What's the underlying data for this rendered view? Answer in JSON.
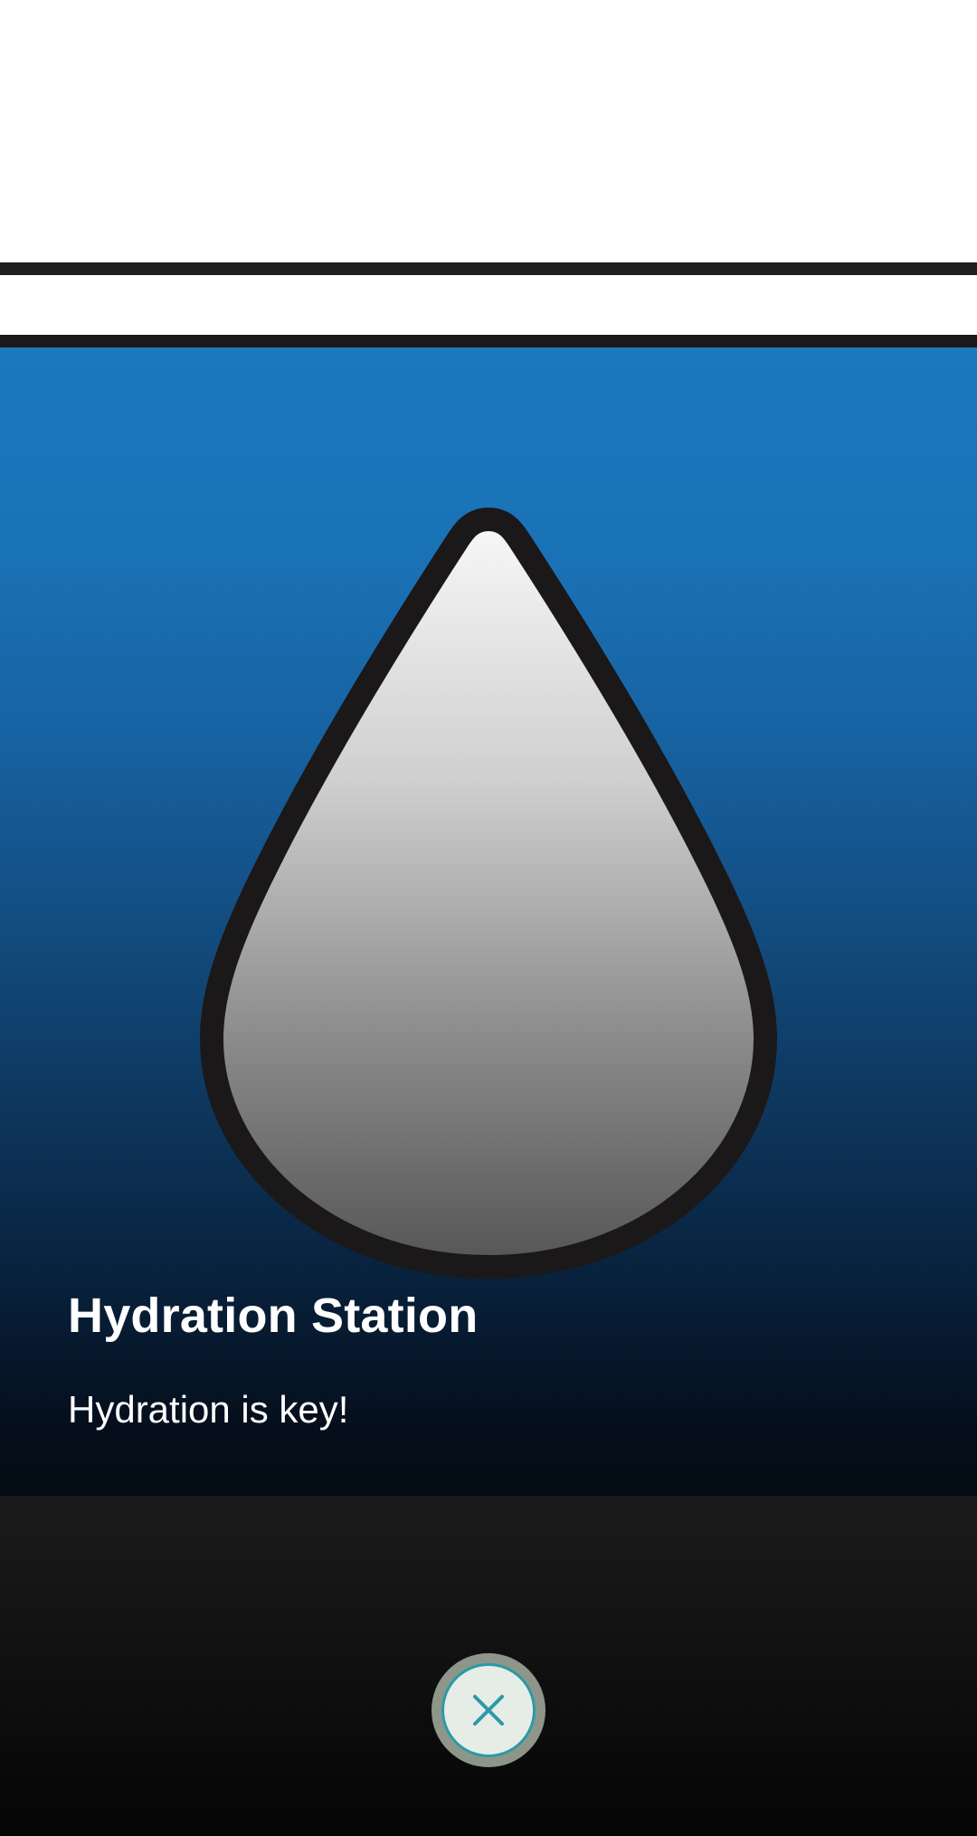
{
  "card": {
    "title": "Hydration Station",
    "description": "Hydration is key!",
    "icon": "water-drop-icon"
  },
  "close_button": {
    "icon": "close-icon"
  },
  "colors": {
    "card_top": "#1b78be",
    "card_bottom": "#040b14",
    "border": "#1b1819",
    "close_accent": "#2b9aa6"
  }
}
